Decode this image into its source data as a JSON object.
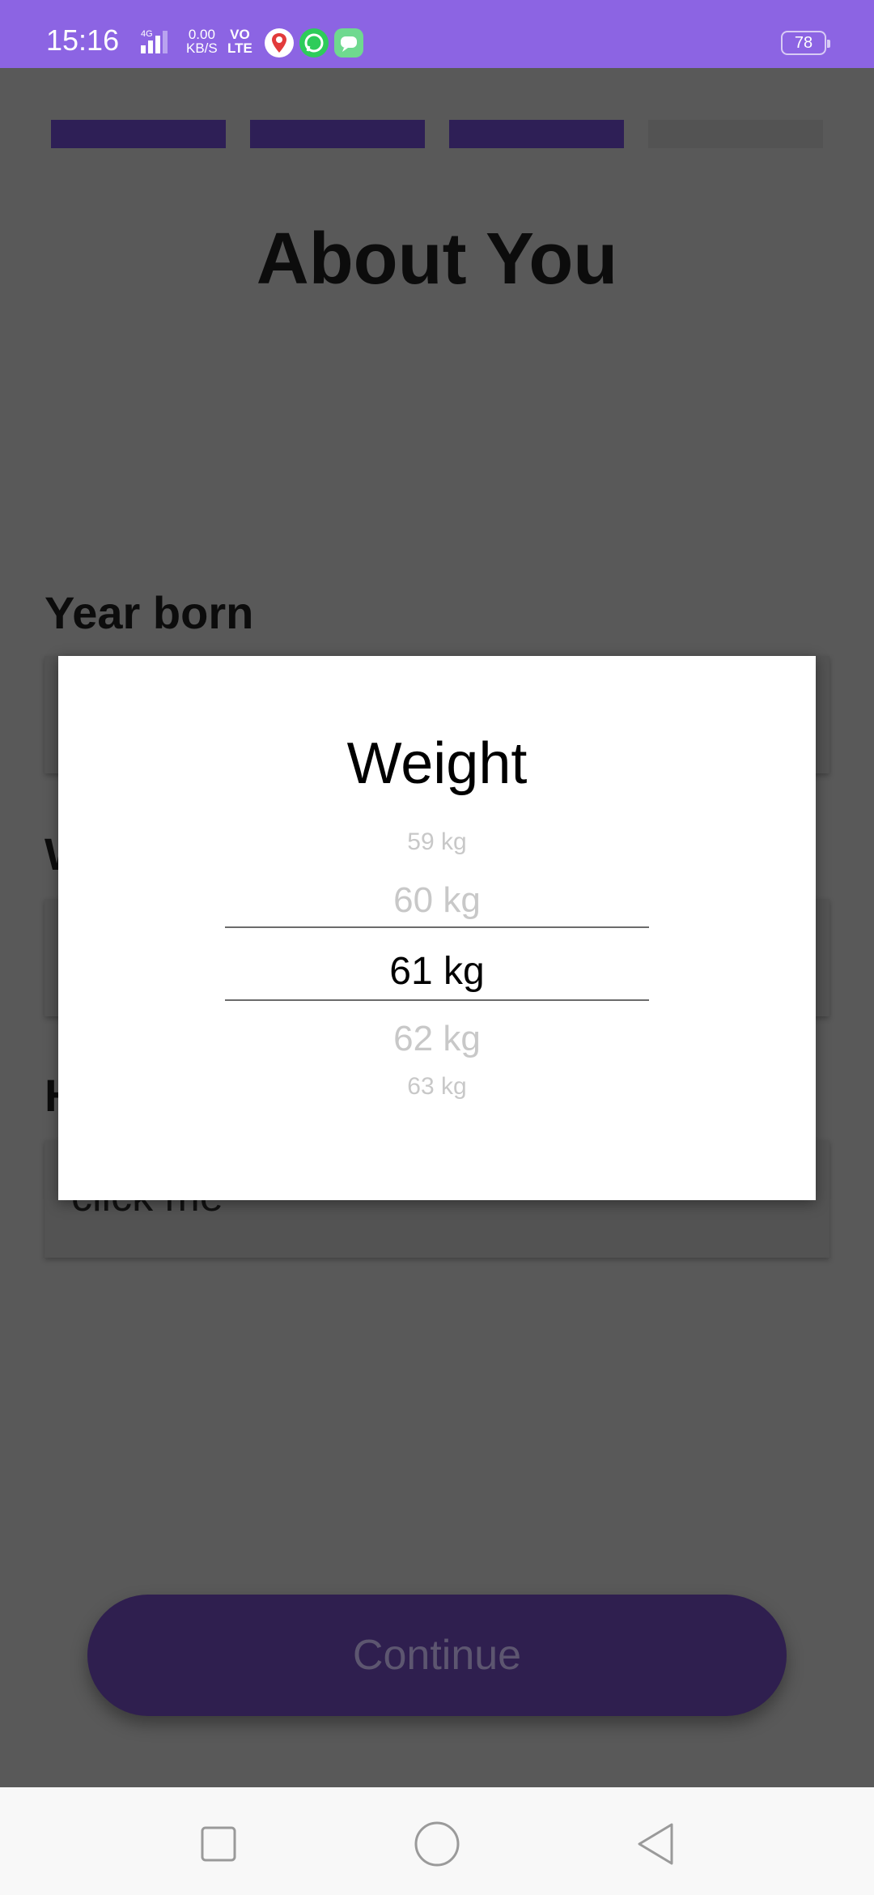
{
  "status_bar": {
    "time": "15:16",
    "network": "4G",
    "net_speed_value": "0.00",
    "net_speed_unit": "KB/S",
    "volte_top": "VO",
    "volte_bottom": "LTE",
    "battery": "78"
  },
  "progress": {
    "total_steps": 4,
    "completed_steps": 3
  },
  "page": {
    "title": "About You",
    "fields": [
      {
        "label": "Year born",
        "value": ""
      },
      {
        "label": "W",
        "value": ""
      },
      {
        "label": "H",
        "value": "click me"
      }
    ]
  },
  "dialog": {
    "title": "Weight",
    "picker_items": [
      "59 kg",
      "60 kg",
      "61 kg",
      "62 kg",
      "63 kg"
    ],
    "selected": "61 kg"
  },
  "continue_button": {
    "label": "Continue"
  },
  "colors": {
    "status_bar": "#8c64e3",
    "progress_active": "#2e1f56",
    "progress_inactive": "#535353",
    "button_bg": "#2f1f4f",
    "overlay_bg": "#595959"
  },
  "nav": {
    "icons": [
      "recent-apps-icon",
      "home-icon",
      "back-icon"
    ]
  }
}
